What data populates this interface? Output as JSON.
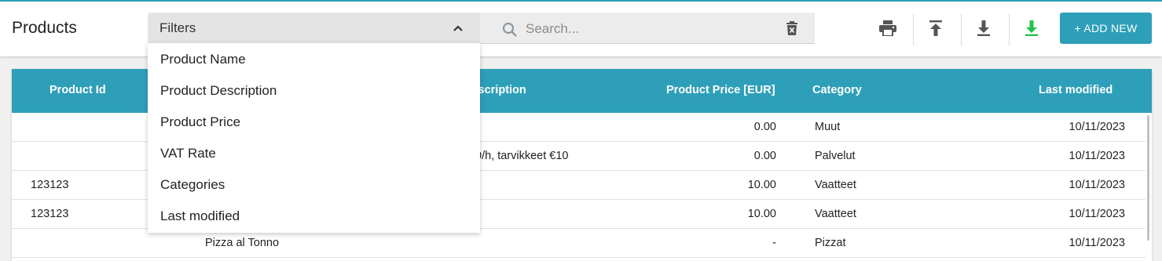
{
  "header": {
    "title": "Products",
    "filters_label": "Filters",
    "search_placeholder": "Search...",
    "add_new_label": "+ ADD NEW",
    "accent_color": "#2e9fb9",
    "tools": [
      "printer-icon",
      "upload-icon",
      "download-icon",
      "download-green-icon"
    ]
  },
  "filter_menu": {
    "items": [
      "Product Name",
      "Product Description",
      "Product Price",
      "VAT Rate",
      "Categories",
      "Last modified"
    ]
  },
  "table": {
    "columns": [
      "Product Id",
      "Description",
      "Product Price [EUR]",
      "Category",
      "Last modified"
    ],
    "rows": [
      {
        "id": "",
        "name": "",
        "description": "",
        "price": "0.00",
        "category": "Muut",
        "modified": "10/11/2023"
      },
      {
        "id": "",
        "name": "",
        "description": "0/h, tarvikkeet €10",
        "price": "0.00",
        "category": "Palvelut",
        "modified": "10/11/2023"
      },
      {
        "id": "123123",
        "name": "",
        "description": "",
        "price": "10.00",
        "category": "Vaatteet",
        "modified": "10/11/2023"
      },
      {
        "id": "123123",
        "name": "",
        "description": "",
        "price": "10.00",
        "category": "Vaatteet",
        "modified": "10/11/2023"
      },
      {
        "id": "",
        "name": "Pizza al Tonno",
        "description": "",
        "price": "-",
        "category": "Pizzat",
        "modified": "10/11/2023"
      }
    ]
  }
}
